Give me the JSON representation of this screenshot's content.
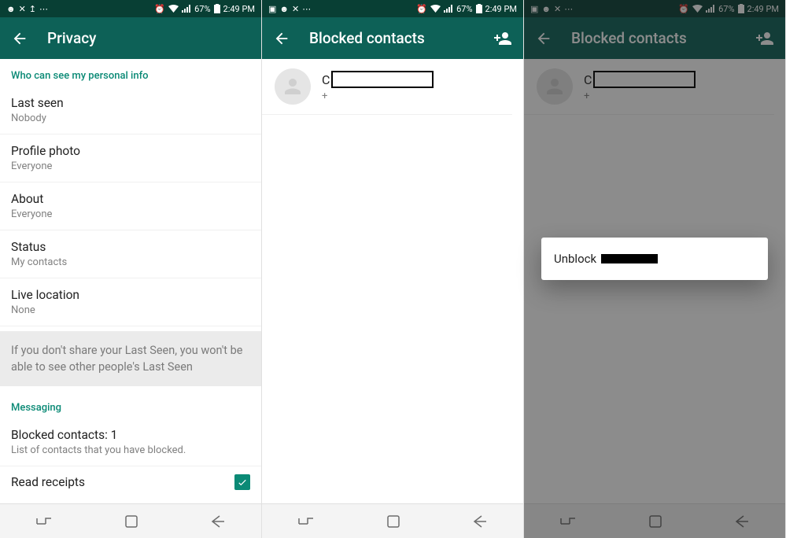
{
  "statusbar": {
    "battery": "67%",
    "time": "2:49 PM"
  },
  "phone1": {
    "title": "Privacy",
    "section_personal": "Who can see my personal info",
    "items": [
      {
        "label": "Last seen",
        "value": "Nobody"
      },
      {
        "label": "Profile photo",
        "value": "Everyone"
      },
      {
        "label": "About",
        "value": "Everyone"
      },
      {
        "label": "Status",
        "value": "My contacts"
      },
      {
        "label": "Live location",
        "value": "None"
      }
    ],
    "info_text": "If you don't share your Last Seen, you won't be able to see other people's Last Seen",
    "section_messaging": "Messaging",
    "blocked": {
      "label": "Blocked contacts: 1",
      "value": "List of contacts that you have blocked."
    },
    "read_receipts_label": "Read receipts"
  },
  "phone2": {
    "title": "Blocked contacts",
    "contact": {
      "name_first_letter": "C",
      "number_prefix": "+"
    }
  },
  "phone3": {
    "title": "Blocked contacts",
    "contact": {
      "name_first_letter": "C",
      "number_prefix": "+"
    },
    "modal": {
      "unblock_label": "Unblock"
    }
  }
}
